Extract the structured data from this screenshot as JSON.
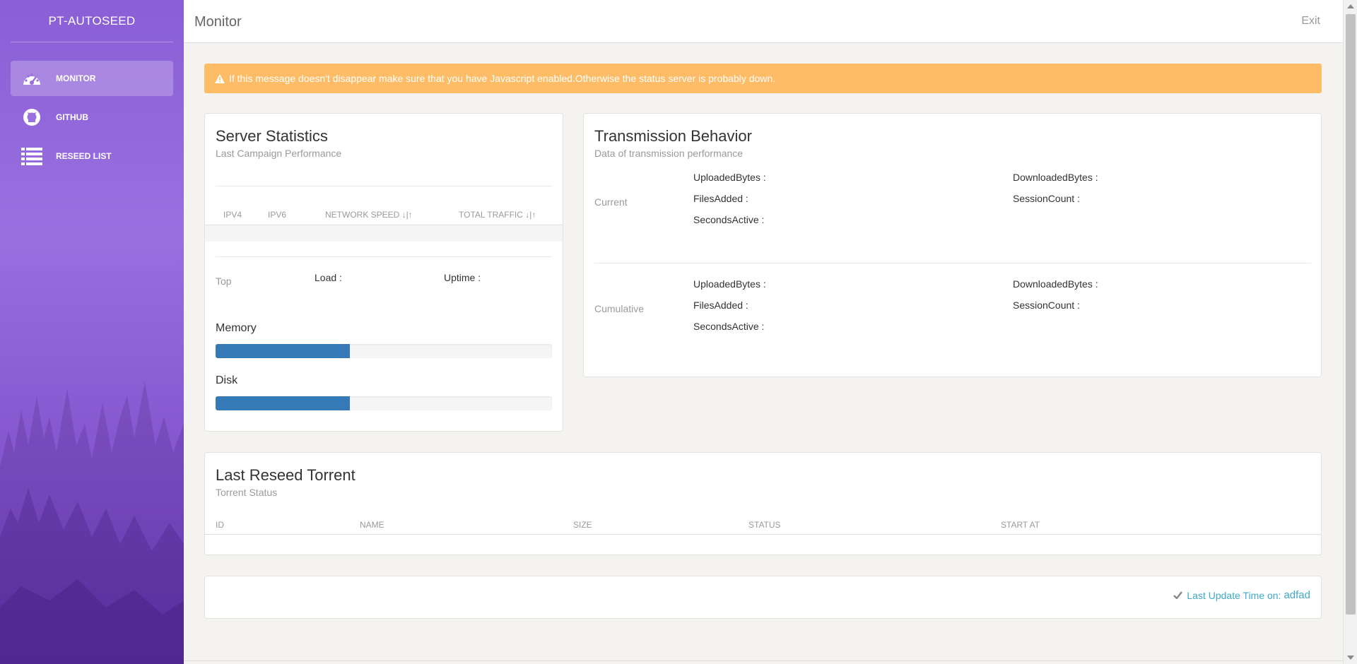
{
  "brand": "PT-AUTOSEED",
  "sidebar": {
    "items": [
      {
        "label": "MONITOR",
        "icon": "dashboard-icon",
        "active": true
      },
      {
        "label": "GITHUB",
        "icon": "github-icon",
        "active": false
      },
      {
        "label": "RESEED LIST",
        "icon": "list-icon",
        "active": false
      }
    ]
  },
  "header": {
    "title": "Monitor",
    "exit": "Exit"
  },
  "alert": {
    "text": "If this message doesn't disappear make sure that you have Javascript enabled.Otherwise the status server is probably down."
  },
  "server_stats": {
    "title": "Server Statistics",
    "subtitle": "Last Campaign Performance",
    "columns": [
      "IPV4",
      "IPV6",
      "NETWORK SPEED ↓|↑",
      "TOTAL TRAFFIC ↓|↑"
    ],
    "top_label": "Top",
    "load_label": "Load :",
    "uptime_label": "Uptime :",
    "memory_label": "Memory",
    "memory_percent": 40,
    "disk_label": "Disk",
    "disk_percent": 40
  },
  "transmission": {
    "title": "Transmission Behavior",
    "subtitle": "Data of transmission performance",
    "current_label": "Current",
    "cumulative_label": "Cumulative",
    "fields": {
      "uploaded": "UploadedBytes :",
      "downloaded": "DownloadedBytes :",
      "files": "FilesAdded :",
      "session": "SessionCount :",
      "seconds": "SecondsActive :"
    }
  },
  "reseed": {
    "title": "Last Reseed Torrent",
    "subtitle": "Torrent Status",
    "columns": [
      "ID",
      "NAME",
      "SIZE",
      "STATUS",
      "START AT"
    ]
  },
  "footer": {
    "update_label": "Last Update Time on:",
    "update_value": "adfad"
  },
  "colors": {
    "accent": "#8a5fd6",
    "alert": "#ffbc67",
    "progress": "#337ab7",
    "info": "#3ea8c9"
  }
}
